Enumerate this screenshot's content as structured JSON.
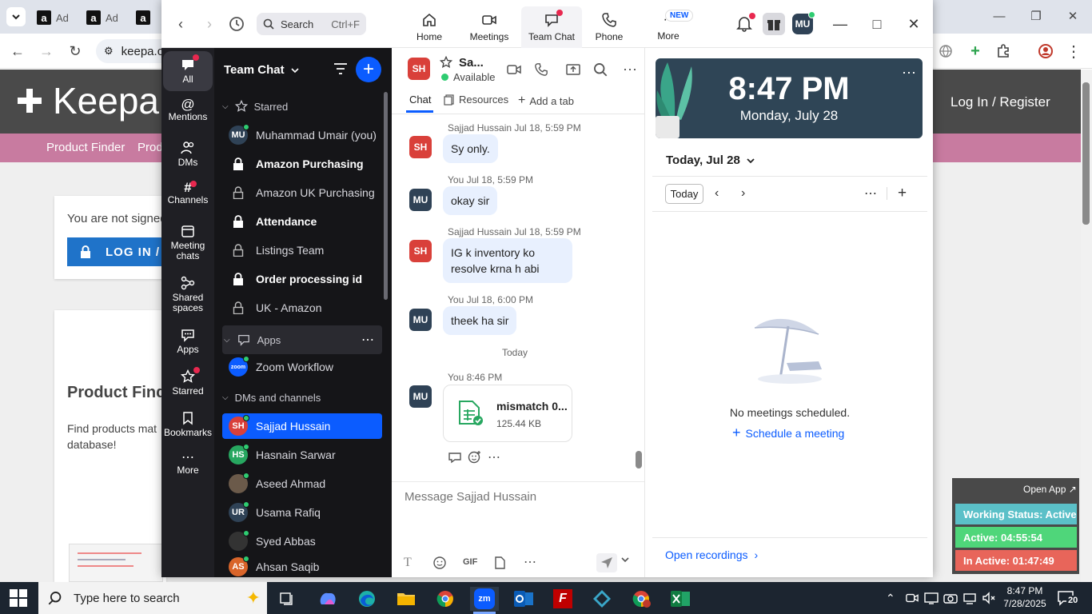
{
  "browser": {
    "tab_label": "Ad",
    "address": "keepa.c",
    "site": {
      "logo": "Keepa",
      "login": "Log In / Register",
      "nav": [
        "Product Finder",
        "Prod"
      ],
      "not_signed": "You are not signed",
      "login_button": "LOG IN / R",
      "finder_title": "Product Finde",
      "finder_desc_1": "Find products mat",
      "finder_desc_2": "database!"
    }
  },
  "zoom": {
    "search": {
      "label": "Search",
      "shortcut": "Ctrl+F"
    },
    "nav_tabs": [
      {
        "label": "Home"
      },
      {
        "label": "Meetings"
      },
      {
        "label": "Team Chat"
      },
      {
        "label": "Phone"
      },
      {
        "label": "More"
      }
    ],
    "new_badge": "NEW",
    "user_initials": "MU",
    "rail": [
      {
        "label": "All"
      },
      {
        "label": "Mentions"
      },
      {
        "label": "DMs"
      },
      {
        "label": "Channels"
      },
      {
        "label": "Meeting chats"
      },
      {
        "label": "Shared spaces"
      },
      {
        "label": "Apps"
      },
      {
        "label": "Starred"
      },
      {
        "label": "Bookmarks"
      },
      {
        "label": "More"
      }
    ],
    "list": {
      "title": "Team Chat",
      "sections": {
        "starred": "Starred",
        "apps": "Apps",
        "dms": "DMs and channels"
      },
      "starred": [
        {
          "label": "Muhammad Umair (you)",
          "initials": "MU"
        },
        {
          "label": "Amazon Purchasing"
        },
        {
          "label": "Amazon UK Purchasing"
        },
        {
          "label": "Attendance"
        },
        {
          "label": "Listings Team"
        },
        {
          "label": "Order processing id"
        },
        {
          "label": "UK - Amazon"
        }
      ],
      "apps": [
        {
          "label": "Zoom Workflow",
          "icon_text": "zoom"
        }
      ],
      "dms": [
        {
          "label": "Sajjad Hussain",
          "initials": "SH"
        },
        {
          "label": "Hasnain Sarwar",
          "initials": "HS"
        },
        {
          "label": "Aseed Ahmad",
          "initials": ""
        },
        {
          "label": "Usama Rafiq",
          "initials": "UR"
        },
        {
          "label": "Syed Abbas",
          "initials": ""
        },
        {
          "label": "Ahsan Saqib",
          "initials": "AS"
        }
      ]
    },
    "chat": {
      "contact_initials": "SH",
      "contact_name": "Sa...",
      "status": "Available",
      "tabs": [
        "Chat",
        "Resources",
        "Add a tab"
      ],
      "messages": [
        {
          "initials": "SH",
          "meta": "Sajjad Hussain Jul 18, 5:59 PM",
          "text": "Sy only."
        },
        {
          "initials": "MU",
          "meta": "You Jul 18, 5:59 PM",
          "text": "okay sir"
        },
        {
          "initials": "SH",
          "meta": "Sajjad Hussain Jul 18, 5:59 PM",
          "text": "IG k inventory ko resolve krna h abi"
        },
        {
          "initials": "MU",
          "meta": "You Jul 18, 6:00 PM",
          "text": "theek ha sir"
        }
      ],
      "day_divider": "Today",
      "file_message": {
        "initials": "MU",
        "meta": "You 8:46 PM",
        "file_name": "mismatch 0...",
        "file_size": "125.44 KB"
      },
      "composer_placeholder": "Message Sajjad Hussain",
      "gif_label": "GIF"
    },
    "calendar": {
      "time": "8:47 PM",
      "date": "Monday, July 28",
      "day_label": "Today, Jul 28",
      "today_btn": "Today",
      "empty_text": "No meetings scheduled.",
      "schedule_link": "Schedule a meeting",
      "recordings_link": "Open recordings"
    }
  },
  "widget": {
    "open_app": "Open App ↗",
    "working_status": "Working Status: Active",
    "active": "Active: 04:55:54",
    "inactive": "In Active: 01:47:49",
    "colors": {
      "status": "#5bc0c8",
      "active": "#4fd67a",
      "inactive": "#e8655a"
    }
  },
  "taskbar": {
    "search_placeholder": "Type here to search",
    "time": "8:47 PM",
    "date": "7/28/2025",
    "notifications": "20"
  },
  "colors": {
    "zoom_blue": "#0b5cff",
    "rail_bg": "#1f1f24",
    "list_bg": "#151518",
    "sh_avatar": "#d9403a",
    "mu_avatar": "#2f4256"
  }
}
